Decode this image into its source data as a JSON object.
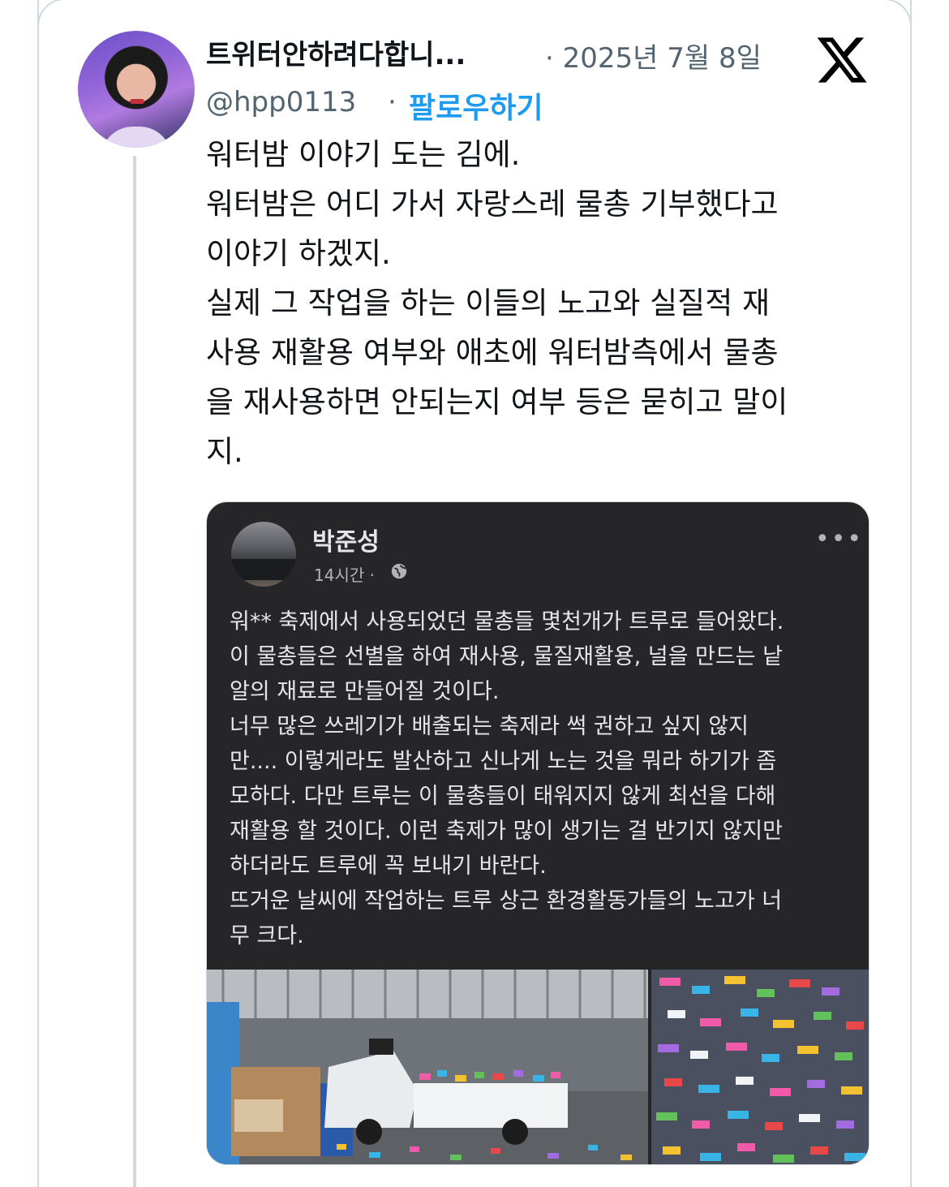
{
  "tweet": {
    "display_name": "트위터안하려다합니...",
    "date": "· 2025년 7월 8일",
    "handle": "@hpp0113",
    "separator": "·",
    "follow_label": "팔로우하기",
    "text_lines": [
      "워터밤 이야기 도는 김에.",
      "워터밤은 어디 가서 자랑스레 물총 기부했다고",
      "이야기 하겠지.",
      "실제 그 작업을 하는 이들의 노고와 실질적 재",
      "사용 재활용 여부와 애초에 워터밤측에서 물총",
      "을 재사용하면 안되는지 여부 등은 묻히고 말이",
      "지."
    ]
  },
  "embedded_post": {
    "author": "박준성",
    "time": "14시간 ·",
    "more_label": "•••",
    "text_lines": [
      "워** 축제에서 사용되었던 물총들 몇천개가 트루로 들어왔다.",
      "이 물총들은 선별을 하여 재사용, 물질재활용, 널을 만드는 낱",
      "알의 재료로 만들어질 것이다.",
      "너무 많은 쓰레기가 배출되는 축제라 썩 권하고 싶지 않지",
      "만.... 이렇게라도 발산하고 신나게 노는 것을 뭐라 하기가 좀",
      "모하다. 다만 트루는 이 물총들이 태워지지 않게 최선을 다해",
      "재활용 할 것이다. 이런 축제가 많이 생기는 걸 반기지 않지만",
      "하더라도 트루에 꼭 보내기 바란다.",
      "뜨거운 날씨에 작업하는 트루 상근 환경활동가들의 노고가 너",
      "무 크다."
    ]
  },
  "colors": {
    "follow_blue": "#1d9bf0",
    "muted_gray": "#536471",
    "dark_post_bg": "#262628"
  },
  "icons": [
    "x-logo-icon",
    "globe-icon",
    "more-options-icon"
  ]
}
